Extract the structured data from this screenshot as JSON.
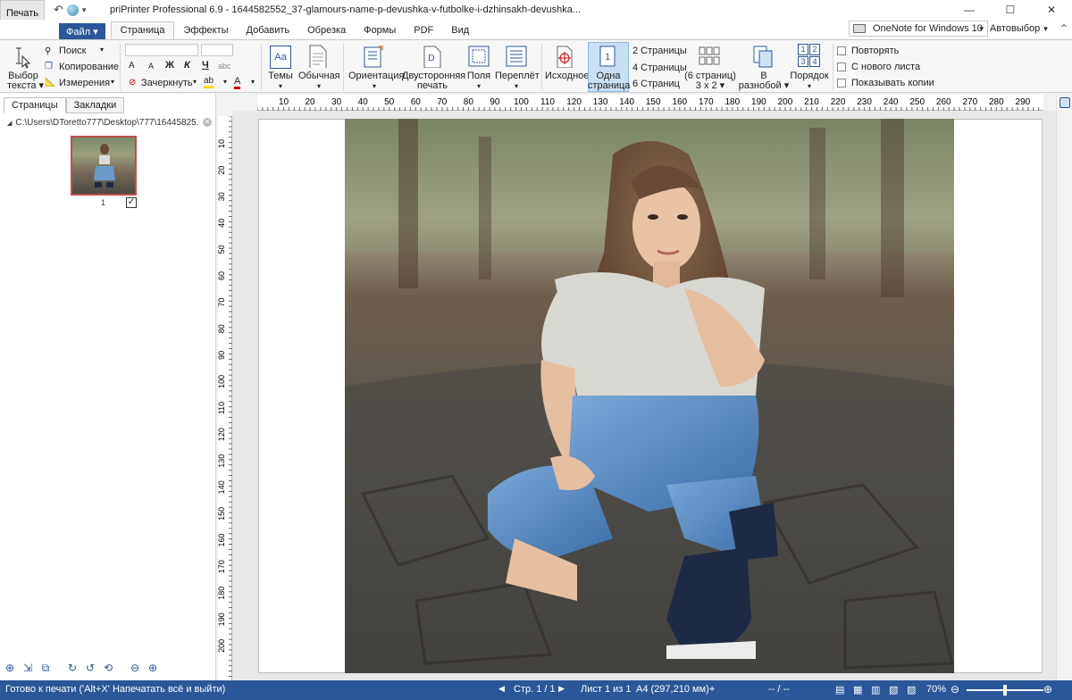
{
  "titlebar": {
    "print_button": "Печать",
    "title": "priPrinter Professional 6.9 - 1644582552_37-glamours-name-p-devushka-v-futbolke-i-dzhinsakh-devushka...",
    "minimize": "—",
    "maximize": "☐",
    "close": "✕"
  },
  "menu": {
    "file": "Файл ▾",
    "tabs": [
      "Страница",
      "Эффекты",
      "Добавить",
      "Обрезка",
      "Формы",
      "PDF",
      "Вид"
    ],
    "printer": "OneNote for Windows 10",
    "printer_arrow": "▾",
    "auto": "Автовыбор",
    "auto_arrow": "▾",
    "collapse": "⌃"
  },
  "ribbon": {
    "select_text_line1": "Выбор",
    "select_text_line2": "текста ▾",
    "search": "Поиск",
    "copy": "Копирование",
    "measure": "Измерения",
    "bold": "Ж",
    "italic": "К",
    "underline": "Ч",
    "strike_sample": "abc",
    "font_grow": "A",
    "font_shrink": "A",
    "strikethrough": "Зачеркнуть",
    "themes": "Темы",
    "normal": "Обычная",
    "orientation": "Ориентация",
    "duplex_line1": "Двусторонняя",
    "duplex_line2": "печать",
    "margins": "Поля",
    "binding": "Переплёт",
    "original": "Исходное",
    "one_page_line1": "Одна",
    "one_page_line2": "страница",
    "two_pages": "2 Страницы",
    "four_pages": "4 Страницы",
    "six_pages": "6 Страниц",
    "six_grid_line1": "(6 страниц)",
    "six_grid_line2": "3 x 2 ▾",
    "scattered_line1": "В",
    "scattered_line2": "разнобой ▾",
    "order": "Порядок",
    "order_nums": [
      "1",
      "2",
      "3",
      "4"
    ],
    "repeat": "Повторять",
    "new_sheet": "С нового листа",
    "show_copies": "Показывать копии"
  },
  "leftpanel": {
    "tab_pages": "Страницы",
    "tab_bookmarks": "Закладки",
    "path": "C:\\Users\\DToretto777\\Desktop\\777\\16445825...",
    "page_number": "1",
    "checked": "✓"
  },
  "ruler": {
    "h_labels": [
      "10",
      "20",
      "30",
      "40",
      "50",
      "60",
      "70",
      "80",
      "90",
      "100",
      "110",
      "120",
      "130",
      "140",
      "150",
      "160",
      "170",
      "180",
      "190",
      "200",
      "210",
      "220",
      "230",
      "240",
      "250",
      "260",
      "270",
      "280",
      "290"
    ],
    "v_labels": [
      "10",
      "20",
      "30",
      "40",
      "50",
      "60",
      "70",
      "80",
      "90",
      "100",
      "110",
      "120",
      "130",
      "140",
      "150",
      "160",
      "170",
      "180",
      "190",
      "200"
    ]
  },
  "status": {
    "ready": "Готово к печати ('Alt+X' Напечатать всё и выйти)",
    "page": "Стр. 1 / 1",
    "sheet": "Лист 1 из 1",
    "size": "A4 (297,210 мм)",
    "coords": "-- / --",
    "zoom": "70%",
    "zoom_level": 0.5
  },
  "colors": {
    "accent": "#2b579a",
    "thumb_border": "#c0504d"
  }
}
